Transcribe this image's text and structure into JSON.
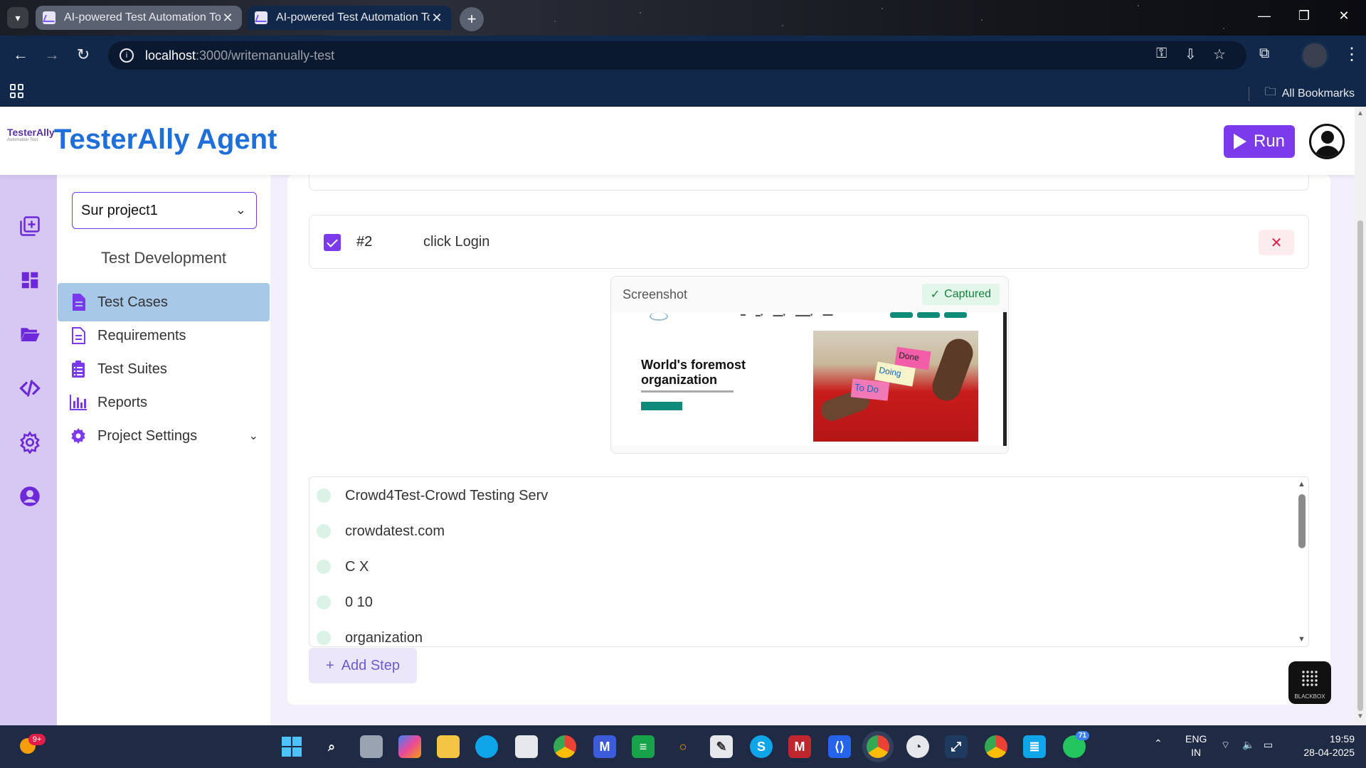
{
  "browser": {
    "tabs": [
      {
        "title": "AI-powered Test Automation To"
      },
      {
        "title": "AI-powered Test Automation To"
      }
    ],
    "url_host": "localhost",
    "url_path": ":3000/writemanually-test",
    "bookmarks_label": "All Bookmarks"
  },
  "app": {
    "brand": "TesterAlly Agent",
    "logo_text": "TesterAlly",
    "logo_tagline": "Automation Tool",
    "run_label": "Run",
    "accent_color": "#7c3aed",
    "brand_color": "#1e6fd9"
  },
  "sidebar": {
    "project": "Sur project1",
    "section_title": "Test Development",
    "items": [
      {
        "label": "Test Cases",
        "icon": "document-icon",
        "active": true
      },
      {
        "label": "Requirements",
        "icon": "document-outline-icon"
      },
      {
        "label": "Test Suites",
        "icon": "clipboard-list-icon"
      },
      {
        "label": "Reports",
        "icon": "bar-chart-icon"
      },
      {
        "label": "Project Settings",
        "icon": "gear-icon"
      }
    ]
  },
  "rail": [
    "add-box-icon",
    "dashboard-icon",
    "folder-open-icon",
    "code-icon",
    "settings-icon",
    "account-circle-icon"
  ],
  "step": {
    "number": "#2",
    "text": "click Login",
    "delete_label": "✕"
  },
  "screenshot": {
    "title": "Screenshot",
    "status": "Captured",
    "hero_text": "World's foremost organization",
    "notes": [
      "Done",
      "Doing",
      "To Do"
    ]
  },
  "suggestions": [
    "Crowd4Test-Crowd Testing Serv",
    "crowdatest.com",
    "C X",
    "0 10",
    "organization"
  ],
  "add_step_label": "Add Step",
  "blackbox_label": "BLACKBOX",
  "taskbar": {
    "weather_badge": "9+",
    "whatsapp_badge": "71",
    "lang_1": "ENG",
    "lang_2": "IN",
    "time": "19:59",
    "date": "28-04-2025"
  }
}
